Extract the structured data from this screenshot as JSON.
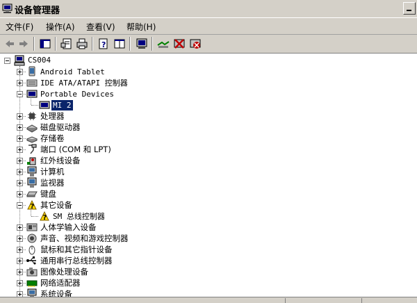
{
  "window": {
    "title": "设备管理器",
    "icon": "device-manager-icon"
  },
  "menu": [
    {
      "label": "文件(F)",
      "name": "menu-file"
    },
    {
      "label": "操作(A)",
      "name": "menu-action"
    },
    {
      "label": "查看(V)",
      "name": "menu-view"
    },
    {
      "label": "帮助(H)",
      "name": "menu-help"
    }
  ],
  "toolbar": [
    "back-arrow-icon",
    "forward-arrow-icon",
    "show-hide-tree-icon",
    "properties-icon",
    "print-icon",
    "help-icon",
    "export-list-icon",
    "scan-hardware-icon",
    "update-driver-icon",
    "disable-device-icon",
    "uninstall-device-icon"
  ],
  "tree": {
    "root": "CS004",
    "items": [
      {
        "label": "Android Tablet",
        "icon": "android-device-icon",
        "level": 1,
        "expander": "plus"
      },
      {
        "label": "IDE ATA/ATAPI 控制器",
        "icon": "ide-controller-icon",
        "level": 1,
        "expander": "plus"
      },
      {
        "label": "Portable Devices",
        "icon": "portable-device-icon",
        "level": 1,
        "expander": "minus"
      },
      {
        "label": "MI 2",
        "icon": "portable-device-icon",
        "level": 2,
        "expander": "none",
        "selected": true
      },
      {
        "label": "处理器",
        "icon": "processor-icon",
        "level": 1,
        "expander": "plus"
      },
      {
        "label": "磁盘驱动器",
        "icon": "disk-drive-icon",
        "level": 1,
        "expander": "plus"
      },
      {
        "label": "存储卷",
        "icon": "storage-volume-icon",
        "level": 1,
        "expander": "plus"
      },
      {
        "label": "端口 (COM 和 LPT)",
        "icon": "port-icon",
        "level": 1,
        "expander": "plus"
      },
      {
        "label": "红外线设备",
        "icon": "infrared-icon",
        "level": 1,
        "expander": "plus"
      },
      {
        "label": "计算机",
        "icon": "computer-icon",
        "level": 1,
        "expander": "plus"
      },
      {
        "label": "监视器",
        "icon": "monitor-icon",
        "level": 1,
        "expander": "plus"
      },
      {
        "label": "键盘",
        "icon": "keyboard-icon",
        "level": 1,
        "expander": "plus"
      },
      {
        "label": "其它设备",
        "icon": "unknown-device-icon",
        "level": 1,
        "expander": "minus"
      },
      {
        "label": "SM 总线控制器",
        "icon": "unknown-device-icon",
        "level": 2,
        "expander": "none"
      },
      {
        "label": "人体学输入设备",
        "icon": "hid-icon",
        "level": 1,
        "expander": "plus"
      },
      {
        "label": "声音、视频和游戏控制器",
        "icon": "sound-icon",
        "level": 1,
        "expander": "plus"
      },
      {
        "label": "鼠标和其它指针设备",
        "icon": "mouse-icon",
        "level": 1,
        "expander": "plus"
      },
      {
        "label": "通用串行总线控制器",
        "icon": "usb-icon",
        "level": 1,
        "expander": "plus"
      },
      {
        "label": "图像处理设备",
        "icon": "imaging-device-icon",
        "level": 1,
        "expander": "plus"
      },
      {
        "label": "网络适配器",
        "icon": "network-adapter-icon",
        "level": 1,
        "expander": "plus"
      },
      {
        "label": "系统设备",
        "icon": "system-device-icon",
        "level": 1,
        "expander": "plus"
      }
    ]
  },
  "colors": {
    "chrome": "#d4d0c8",
    "selection": "#0a246a"
  }
}
